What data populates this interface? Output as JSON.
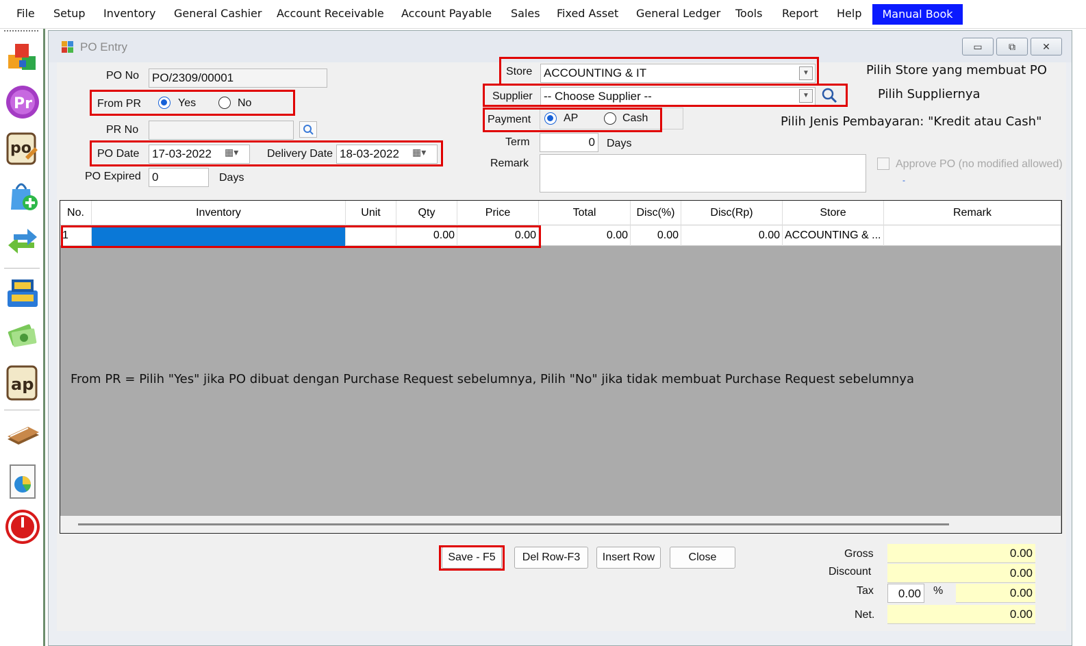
{
  "menubar": {
    "items": [
      "File",
      "Setup",
      "Inventory",
      "General Cashier",
      "Account Receivable",
      "Account Payable",
      "Sales",
      "Fixed Asset",
      "General Ledger",
      "Tools",
      "Report",
      "Help"
    ],
    "active": "Manual Book"
  },
  "toolbar": {
    "icons": [
      "inventory-boxes-icon",
      "purchase-request-icon",
      "purchase-order-icon",
      "shopping-bag-add-icon",
      "transfer-arrows-icon",
      "cashier-register-icon",
      "money-icon",
      "account-payable-icon",
      "ledger-book-icon",
      "report-chart-icon",
      "power-off-icon"
    ]
  },
  "window": {
    "title": "PO Entry",
    "buttons": [
      "▭",
      "⧉",
      "✕"
    ]
  },
  "form": {
    "po_no_label": "PO No",
    "po_no_value": "PO/2309/00001",
    "from_pr_label": "From PR",
    "from_pr_yes": "Yes",
    "from_pr_no": "No",
    "pr_no_label": "PR No",
    "pr_no_value": "",
    "po_date_label": "PO Date",
    "po_date_value": "17-03-2022",
    "delivery_date_label": "Delivery Date",
    "delivery_date_value": "18-03-2022",
    "po_expired_label": "PO Expired",
    "po_expired_value": "0",
    "days_label": "Days",
    "store_label": "Store",
    "store_value": "ACCOUNTING & IT",
    "supplier_label": "Supplier",
    "supplier_value": "-- Choose Supplier --",
    "payment_label": "Payment",
    "payment_ap": "AP",
    "payment_cash": "Cash",
    "term_label": "Term",
    "term_value": "0",
    "term_days": "Days",
    "remark_label": "Remark",
    "remark_value": "",
    "approve_label": "Approve PO (no modified allowed)",
    "approve_dash": "-"
  },
  "annotations": {
    "store": "Pilih Store yang membuat PO",
    "supplier": "Pilih Suppliernya",
    "payment": "Pilih Jenis Pembayaran: \"Kredit atau Cash\"",
    "from_pr": "From PR = Pilih \"Yes\" jika PO dibuat dengan Purchase Request sebelumnya, Pilih \"No\" jika tidak membuat Purchase Request sebelumnya"
  },
  "grid": {
    "columns": [
      "No.",
      "Inventory",
      "Unit",
      "Qty",
      "Price",
      "Total",
      "Disc(%)",
      "Disc(Rp)",
      "Store",
      "Remark"
    ],
    "rows": [
      {
        "no": "1",
        "inventory": "",
        "unit": "",
        "qty": "0.00",
        "price": "0.00",
        "total": "0.00",
        "disc_pct": "0.00",
        "disc_rp": "0.00",
        "store": "ACCOUNTING & ...",
        "remark": ""
      }
    ]
  },
  "buttons": {
    "save": "Save - F5",
    "del_row": "Del Row-F3",
    "insert_row": "Insert Row",
    "close": "Close"
  },
  "totals": {
    "gross_label": "Gross",
    "gross_value": "0.00",
    "discount_label": "Discount",
    "discount_value": "0.00",
    "tax_label": "Tax",
    "tax_pct": "0.00",
    "pct_sign": "%",
    "tax_value": "0.00",
    "net_label": "Net.",
    "net_value": "0.00"
  },
  "colors": {
    "highlight_box": "#e00000",
    "manual_book_bg": "#0a1aff",
    "selected_cell": "#0a78d7",
    "totals_bg": "#ffffc8"
  }
}
